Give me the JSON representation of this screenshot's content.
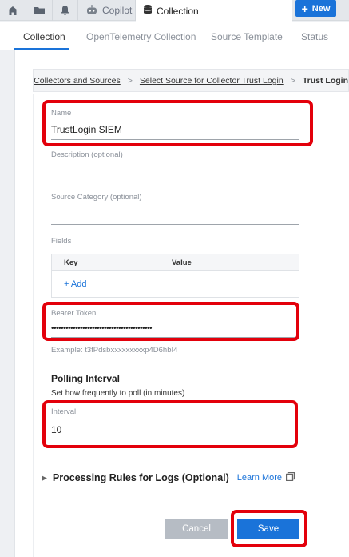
{
  "topbar": {
    "tabs": [
      {
        "label": "Copilot",
        "icon": "copilot-icon"
      },
      {
        "label": "Collection",
        "icon": "database-icon"
      }
    ],
    "nav_icons": [
      "home-icon",
      "folder-icon",
      "bell-icon"
    ],
    "new_button_label": "New"
  },
  "subtabs": [
    "Collection",
    "OpenTelemetry Collection",
    "Source Template",
    "Status"
  ],
  "breadcrumb": {
    "items": [
      "Collectors and Sources",
      "Select Source for Collector Trust Login"
    ],
    "separator": ">",
    "current": "Trust Login"
  },
  "form": {
    "name": {
      "label": "Name",
      "value": "TrustLogin SIEM"
    },
    "description": {
      "label": "Description (optional)",
      "value": ""
    },
    "source_category": {
      "label": "Source Category (optional)",
      "value": ""
    },
    "fields": {
      "label": "Fields",
      "columns": [
        "Key",
        "Value"
      ],
      "add_label": "+ Add"
    },
    "bearer_token": {
      "label": "Bearer Token",
      "value": "••••••••••••••••••••••••••••••••••••••••••",
      "helper": "Example: t3fPdsbxxxxxxxxxp4D6hbI4"
    },
    "polling": {
      "title": "Polling Interval",
      "subtitle": "Set how frequently to poll (in minutes)",
      "interval_label": "Interval",
      "interval_value": "10"
    },
    "processing_rules": {
      "title": "Processing Rules for Logs (Optional)",
      "learn_more": "Learn More"
    }
  },
  "actions": {
    "cancel": "Cancel",
    "save": "Save"
  },
  "colors": {
    "accent": "#1a73d9",
    "highlight": "#e3000b",
    "cancel_bg": "#b6bcc4"
  }
}
